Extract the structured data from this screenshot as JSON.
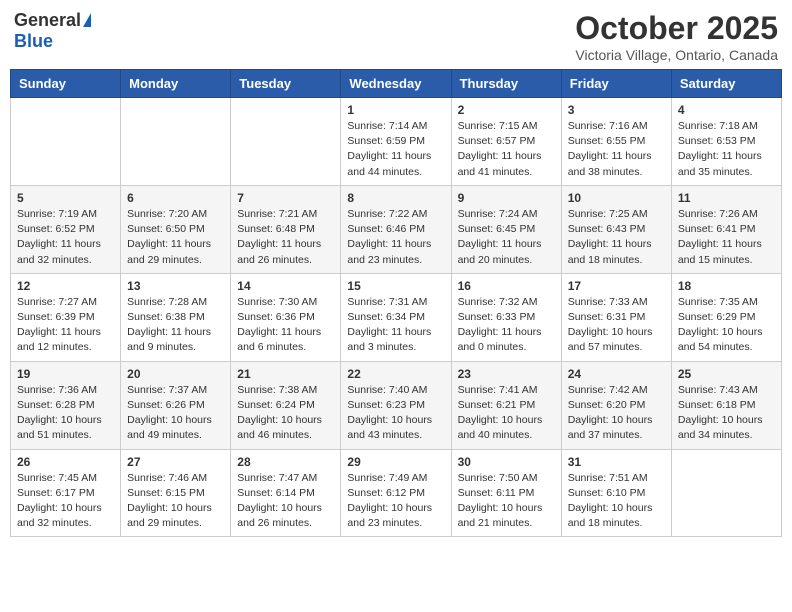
{
  "header": {
    "logo_general": "General",
    "logo_blue": "Blue",
    "month_title": "October 2025",
    "location": "Victoria Village, Ontario, Canada"
  },
  "days_of_week": [
    "Sunday",
    "Monday",
    "Tuesday",
    "Wednesday",
    "Thursday",
    "Friday",
    "Saturday"
  ],
  "weeks": [
    [
      {
        "day": "",
        "info": ""
      },
      {
        "day": "",
        "info": ""
      },
      {
        "day": "",
        "info": ""
      },
      {
        "day": "1",
        "info": "Sunrise: 7:14 AM\nSunset: 6:59 PM\nDaylight: 11 hours and 44 minutes."
      },
      {
        "day": "2",
        "info": "Sunrise: 7:15 AM\nSunset: 6:57 PM\nDaylight: 11 hours and 41 minutes."
      },
      {
        "day": "3",
        "info": "Sunrise: 7:16 AM\nSunset: 6:55 PM\nDaylight: 11 hours and 38 minutes."
      },
      {
        "day": "4",
        "info": "Sunrise: 7:18 AM\nSunset: 6:53 PM\nDaylight: 11 hours and 35 minutes."
      }
    ],
    [
      {
        "day": "5",
        "info": "Sunrise: 7:19 AM\nSunset: 6:52 PM\nDaylight: 11 hours and 32 minutes."
      },
      {
        "day": "6",
        "info": "Sunrise: 7:20 AM\nSunset: 6:50 PM\nDaylight: 11 hours and 29 minutes."
      },
      {
        "day": "7",
        "info": "Sunrise: 7:21 AM\nSunset: 6:48 PM\nDaylight: 11 hours and 26 minutes."
      },
      {
        "day": "8",
        "info": "Sunrise: 7:22 AM\nSunset: 6:46 PM\nDaylight: 11 hours and 23 minutes."
      },
      {
        "day": "9",
        "info": "Sunrise: 7:24 AM\nSunset: 6:45 PM\nDaylight: 11 hours and 20 minutes."
      },
      {
        "day": "10",
        "info": "Sunrise: 7:25 AM\nSunset: 6:43 PM\nDaylight: 11 hours and 18 minutes."
      },
      {
        "day": "11",
        "info": "Sunrise: 7:26 AM\nSunset: 6:41 PM\nDaylight: 11 hours and 15 minutes."
      }
    ],
    [
      {
        "day": "12",
        "info": "Sunrise: 7:27 AM\nSunset: 6:39 PM\nDaylight: 11 hours and 12 minutes."
      },
      {
        "day": "13",
        "info": "Sunrise: 7:28 AM\nSunset: 6:38 PM\nDaylight: 11 hours and 9 minutes."
      },
      {
        "day": "14",
        "info": "Sunrise: 7:30 AM\nSunset: 6:36 PM\nDaylight: 11 hours and 6 minutes."
      },
      {
        "day": "15",
        "info": "Sunrise: 7:31 AM\nSunset: 6:34 PM\nDaylight: 11 hours and 3 minutes."
      },
      {
        "day": "16",
        "info": "Sunrise: 7:32 AM\nSunset: 6:33 PM\nDaylight: 11 hours and 0 minutes."
      },
      {
        "day": "17",
        "info": "Sunrise: 7:33 AM\nSunset: 6:31 PM\nDaylight: 10 hours and 57 minutes."
      },
      {
        "day": "18",
        "info": "Sunrise: 7:35 AM\nSunset: 6:29 PM\nDaylight: 10 hours and 54 minutes."
      }
    ],
    [
      {
        "day": "19",
        "info": "Sunrise: 7:36 AM\nSunset: 6:28 PM\nDaylight: 10 hours and 51 minutes."
      },
      {
        "day": "20",
        "info": "Sunrise: 7:37 AM\nSunset: 6:26 PM\nDaylight: 10 hours and 49 minutes."
      },
      {
        "day": "21",
        "info": "Sunrise: 7:38 AM\nSunset: 6:24 PM\nDaylight: 10 hours and 46 minutes."
      },
      {
        "day": "22",
        "info": "Sunrise: 7:40 AM\nSunset: 6:23 PM\nDaylight: 10 hours and 43 minutes."
      },
      {
        "day": "23",
        "info": "Sunrise: 7:41 AM\nSunset: 6:21 PM\nDaylight: 10 hours and 40 minutes."
      },
      {
        "day": "24",
        "info": "Sunrise: 7:42 AM\nSunset: 6:20 PM\nDaylight: 10 hours and 37 minutes."
      },
      {
        "day": "25",
        "info": "Sunrise: 7:43 AM\nSunset: 6:18 PM\nDaylight: 10 hours and 34 minutes."
      }
    ],
    [
      {
        "day": "26",
        "info": "Sunrise: 7:45 AM\nSunset: 6:17 PM\nDaylight: 10 hours and 32 minutes."
      },
      {
        "day": "27",
        "info": "Sunrise: 7:46 AM\nSunset: 6:15 PM\nDaylight: 10 hours and 29 minutes."
      },
      {
        "day": "28",
        "info": "Sunrise: 7:47 AM\nSunset: 6:14 PM\nDaylight: 10 hours and 26 minutes."
      },
      {
        "day": "29",
        "info": "Sunrise: 7:49 AM\nSunset: 6:12 PM\nDaylight: 10 hours and 23 minutes."
      },
      {
        "day": "30",
        "info": "Sunrise: 7:50 AM\nSunset: 6:11 PM\nDaylight: 10 hours and 21 minutes."
      },
      {
        "day": "31",
        "info": "Sunrise: 7:51 AM\nSunset: 6:10 PM\nDaylight: 10 hours and 18 minutes."
      },
      {
        "day": "",
        "info": ""
      }
    ]
  ]
}
